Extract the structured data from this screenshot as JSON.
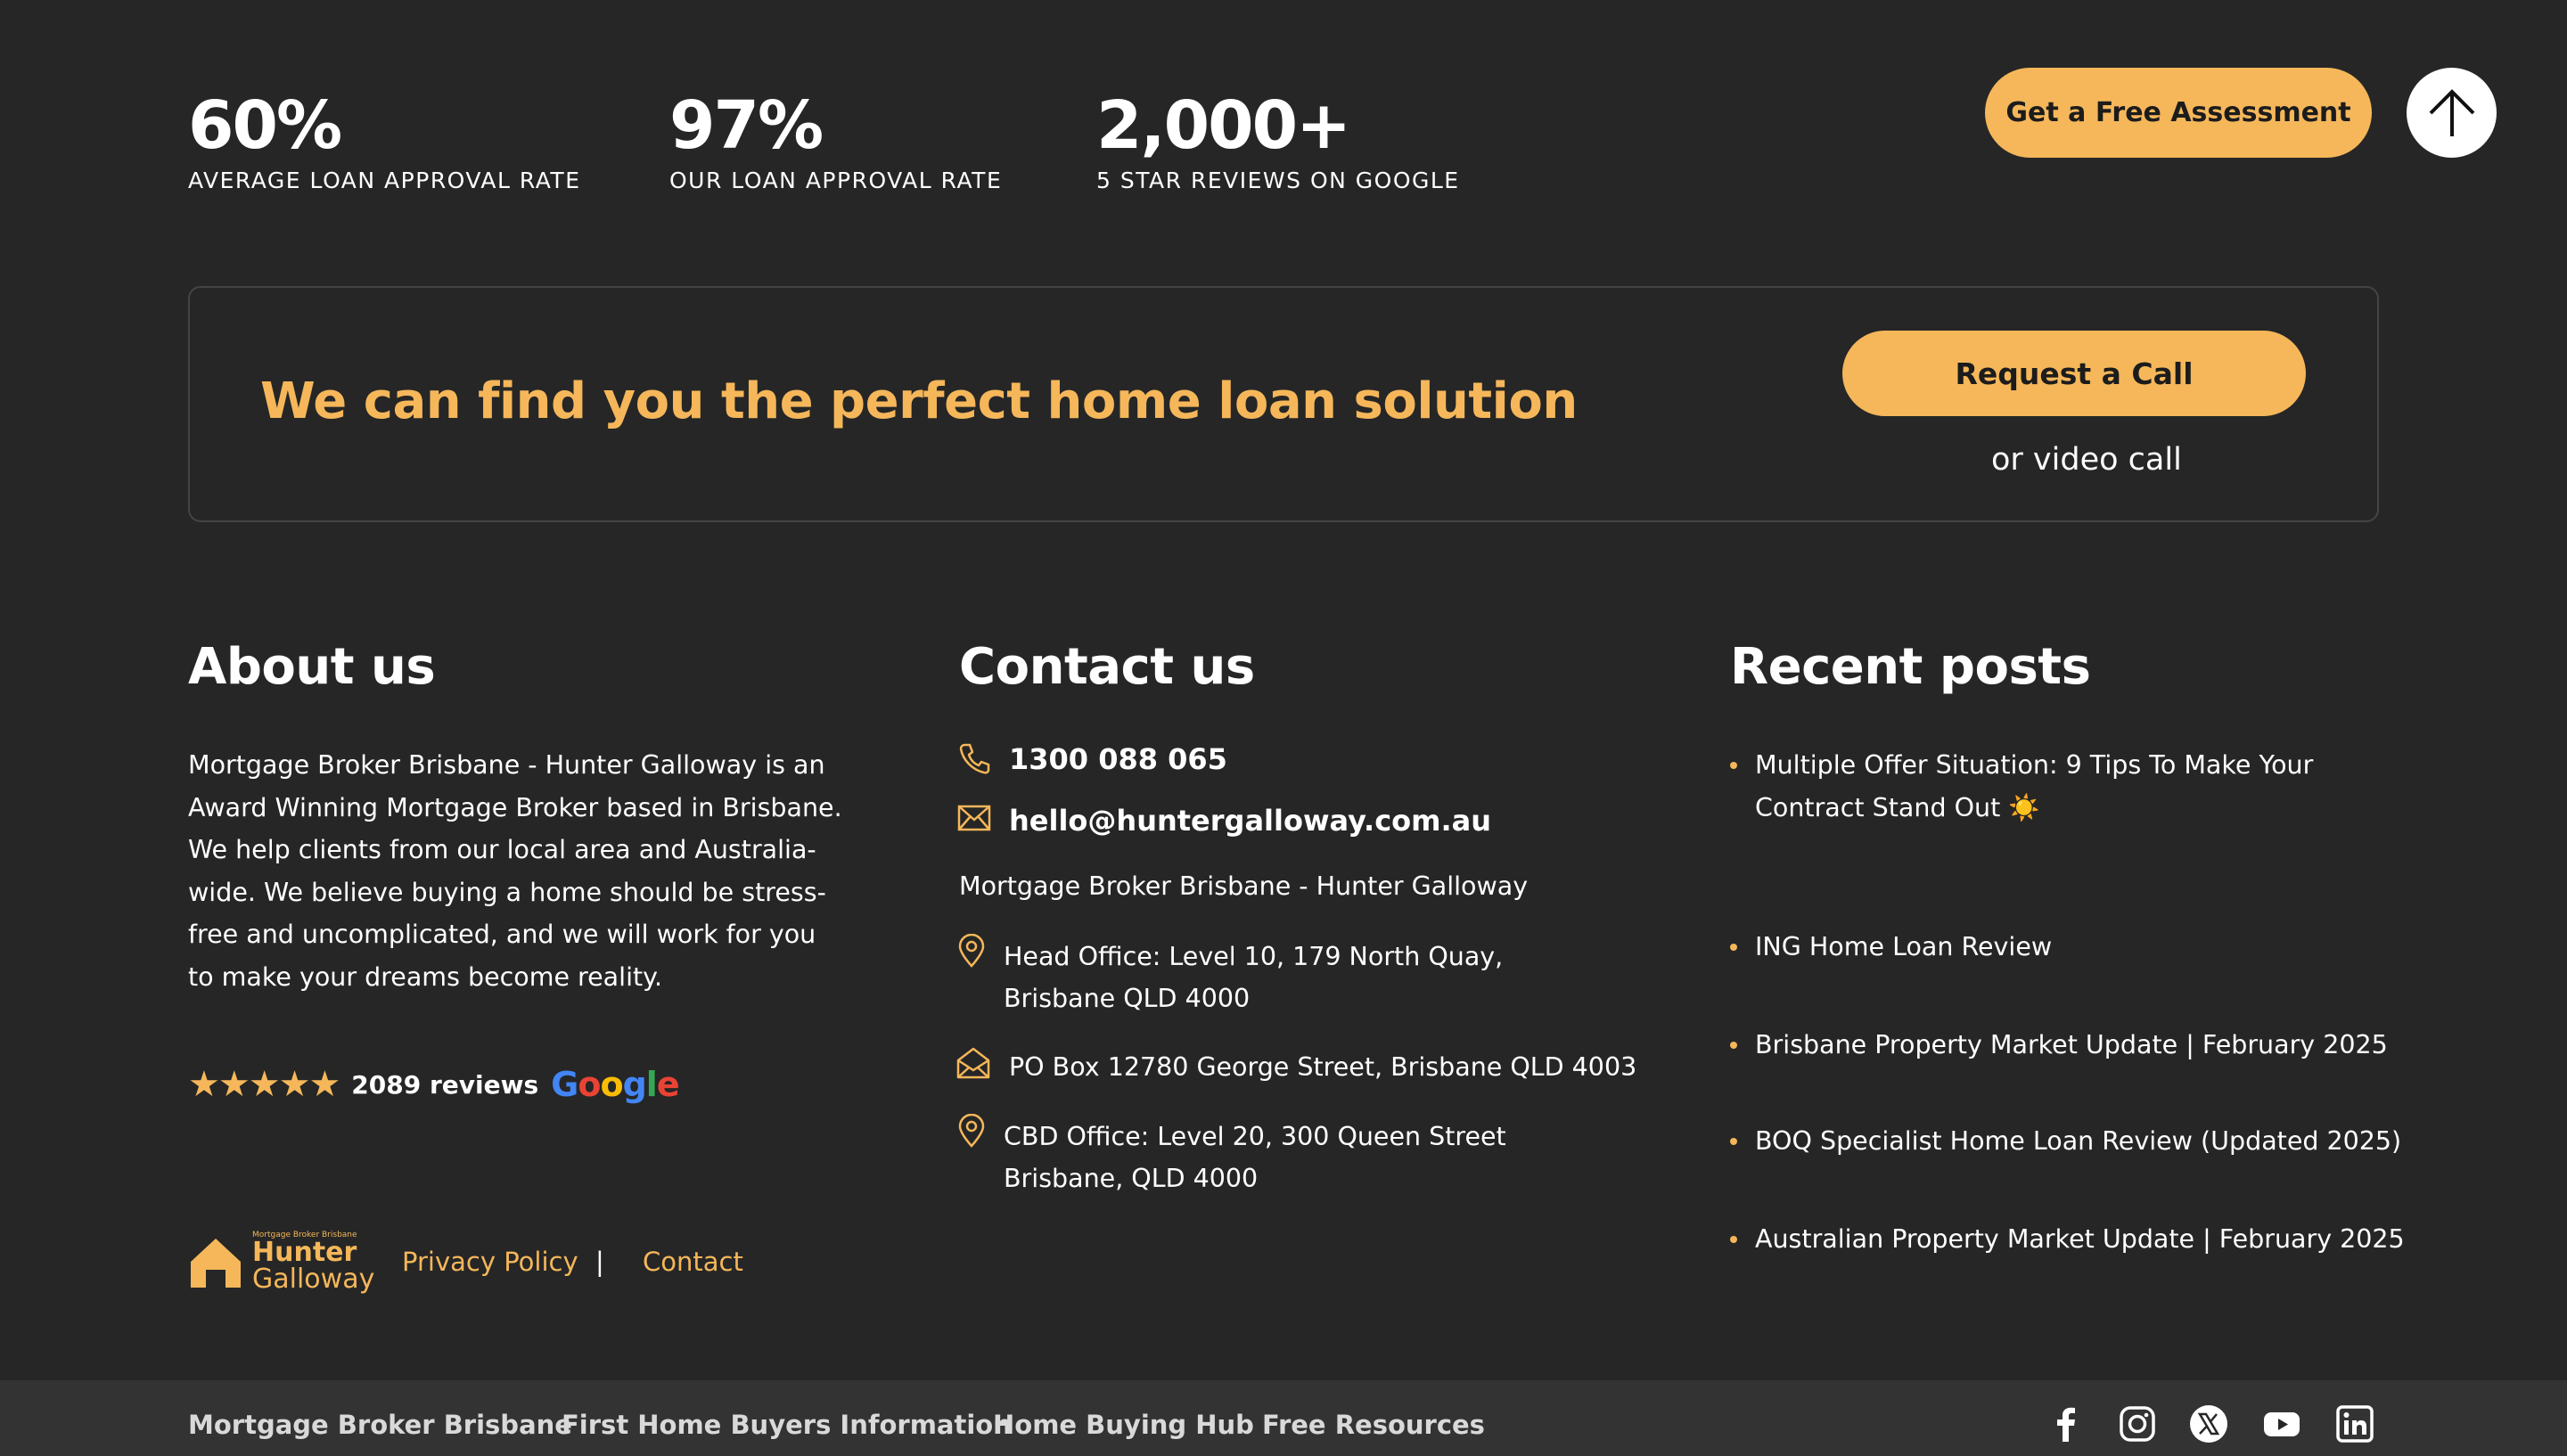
{
  "stats": [
    {
      "value": "60%",
      "label": "AVERAGE LOAN APPROVAL RATE"
    },
    {
      "value": "97%",
      "label": "OUR LOAN APPROVAL RATE"
    },
    {
      "value": "2,000+",
      "label": "5 STAR REVIEWS ON GOOGLE"
    }
  ],
  "header": {
    "assessment_button": "Get a Free Assessment",
    "scroll_top_icon": "arrow-up-icon"
  },
  "cta": {
    "heading": "We can find you the perfect home loan solution",
    "button": "Request a Call",
    "subtext": "or video call"
  },
  "about": {
    "title": "About us",
    "text": "Mortgage Broker Brisbane - Hunter Galloway is an Award Winning Mortgage Broker based in Brisbane. We help clients from our local area and Australia-wide. We believe buying a home should be stress-free and uncomplicated, and we will work for you to make your dreams become reality.",
    "stars": "★★★★★",
    "reviews": "2089 reviews",
    "google": [
      "G",
      "o",
      "o",
      "g",
      "l",
      "e"
    ]
  },
  "contact": {
    "title": "Contact us",
    "phone": "1300 088 065",
    "email": "hello@huntergalloway.com.au",
    "company": "Mortgage Broker Brisbane - Hunter Galloway",
    "head_office": "Head Office: Level 10, 179 North Quay, Brisbane QLD 4000",
    "po_box": "PO Box 12780 George Street, Brisbane QLD 4003",
    "cbd_office": "CBD Office: Level 20, 300 Queen Street Brisbane, QLD 4000"
  },
  "posts": {
    "title": "Recent posts",
    "items": [
      "Multiple Offer Situation: 9 Tips To Make Your Contract Stand Out ☀️",
      "ING Home Loan Review",
      "Brisbane Property Market Update | February 2025",
      "BOQ Specialist Home Loan Review (Updated 2025)",
      "Australian Property Market Update | February 2025"
    ]
  },
  "logo": {
    "small": "Mortgage Broker Brisbane",
    "line1": "Hunter",
    "line2": "Galloway"
  },
  "footer": {
    "privacy": "Privacy Policy",
    "separator": "|",
    "contact": "Contact"
  },
  "bottom_nav": [
    "Mortgage Broker Brisbane",
    "First Home Buyers Information",
    "Home Buying Hub",
    "Free Resources"
  ],
  "social_icons": [
    "facebook-icon",
    "instagram-icon",
    "x-icon",
    "youtube-icon",
    "linkedin-icon"
  ],
  "colors": {
    "background": "#262626",
    "accent": "#F5B75A",
    "bottom_bar": "#333333"
  }
}
